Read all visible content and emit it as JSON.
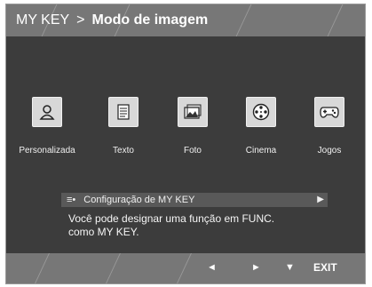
{
  "header": {
    "menu": "MY KEY",
    "separator": ">",
    "title": "Modo de imagem"
  },
  "modes": [
    {
      "label": "Personalizada",
      "icon": "person-icon"
    },
    {
      "label": "Texto",
      "icon": "document-icon"
    },
    {
      "label": "Foto",
      "icon": "photo-icon"
    },
    {
      "label": "Cinema",
      "icon": "film-reel-icon"
    },
    {
      "label": "Jogos",
      "icon": "gamepad-icon"
    }
  ],
  "config": {
    "label": "Configuração de MY KEY",
    "icon": "settings-icon"
  },
  "description": {
    "line1": "Você pode designar uma função em FUNC.",
    "line2": "como MY KEY."
  },
  "footer": {
    "left": "◄",
    "right": "►",
    "down": "▼",
    "exit": "EXIT"
  },
  "colors": {
    "header_bg": "#777777",
    "body_bg": "#3c3c3c",
    "text": "#ffffff"
  }
}
